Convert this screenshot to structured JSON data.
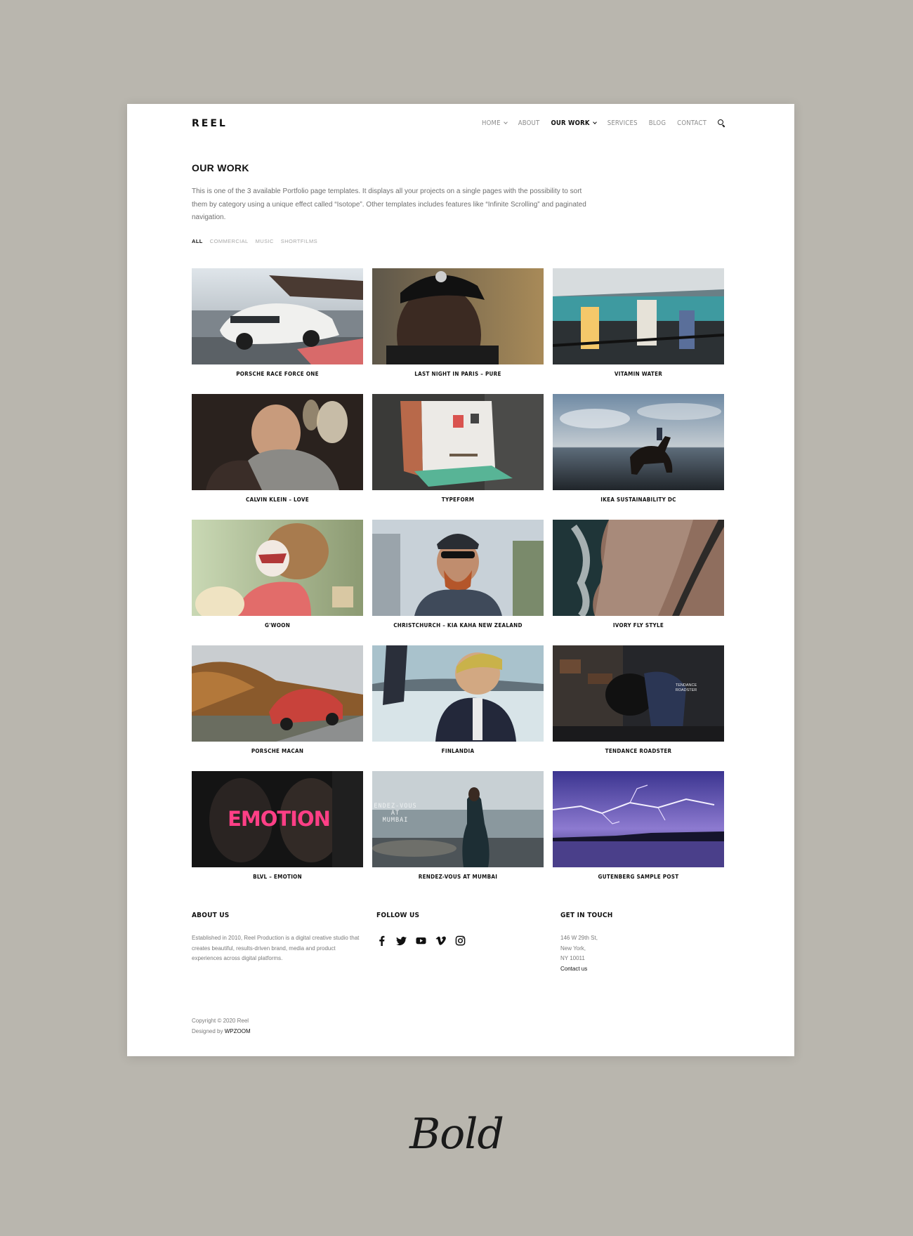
{
  "site": {
    "logo": "REEL"
  },
  "nav": {
    "items": [
      {
        "label": "HOME",
        "dropdown": true,
        "active": false
      },
      {
        "label": "ABOUT",
        "dropdown": false,
        "active": false
      },
      {
        "label": "OUR WORK",
        "dropdown": true,
        "active": true
      },
      {
        "label": "SERVICES",
        "dropdown": false,
        "active": false
      },
      {
        "label": "BLOG",
        "dropdown": false,
        "active": false
      },
      {
        "label": "CONTACT",
        "dropdown": false,
        "active": false
      }
    ],
    "search_icon": "search-icon"
  },
  "page": {
    "title": "OUR WORK",
    "intro": "This is one of the 3 available Portfolio page templates. It displays all your projects on a single pages with the possibility to sort them by category using a unique effect called “Isotope”. Other templates includes features like “Infinite Scrolling” and paginated navigation."
  },
  "filters": [
    "ALL",
    "COMMERCIAL",
    "MUSIC",
    "SHORTFILMS"
  ],
  "projects": [
    {
      "title": "PORSCHE RACE FORCE ONE"
    },
    {
      "title": "LAST NIGHT IN PARIS – PURE"
    },
    {
      "title": "VITAMIN WATER"
    },
    {
      "title": "CALVIN KLEIN – LOVE"
    },
    {
      "title": "TYPEFORM"
    },
    {
      "title": "IKEA SUSTAINABILITY DC"
    },
    {
      "title": "G'WOON"
    },
    {
      "title": "CHRISTCHURCH – KIA KAHA NEW ZEALAND"
    },
    {
      "title": "IVORY FLY STYLE"
    },
    {
      "title": "PORSCHE MACAN"
    },
    {
      "title": "FINLANDIA"
    },
    {
      "title": "TENDANCE ROADSTER"
    },
    {
      "title": "BLVL – EMOTION"
    },
    {
      "title": "RENDEZ-VOUS AT MUMBAI"
    },
    {
      "title": "GUTENBERG SAMPLE POST"
    }
  ],
  "thumb_text": {
    "tendance": "TENDANCE\nROADSTER",
    "emotion": "EMOTION",
    "rendezvous": "ENDEZ-VOUS\nAT\nMUMBAI"
  },
  "footer": {
    "about": {
      "heading": "ABOUT US",
      "text": "Established in 2010, Reel Production is a digital creative studio that creates beautiful, results-driven brand, media and product experiences across digital platforms."
    },
    "follow": {
      "heading": "FOLLOW US",
      "icons": [
        "facebook-icon",
        "twitter-icon",
        "youtube-icon",
        "vimeo-icon",
        "instagram-icon"
      ]
    },
    "contact": {
      "heading": "GET IN TOUCH",
      "line1": "146 W 29th St,",
      "line2": "New York,",
      "line3": "NY 10011",
      "link": "Contact us"
    },
    "copyright": "Copyright © 2020 Reel",
    "designed_prefix": "Designed by",
    "designed_by": "WPZOOM"
  },
  "caption": "Bold",
  "colors": {
    "background": "#b9b6ae",
    "sheet": "#ffffff",
    "text": "#111111",
    "muted": "#8d8d8d"
  }
}
